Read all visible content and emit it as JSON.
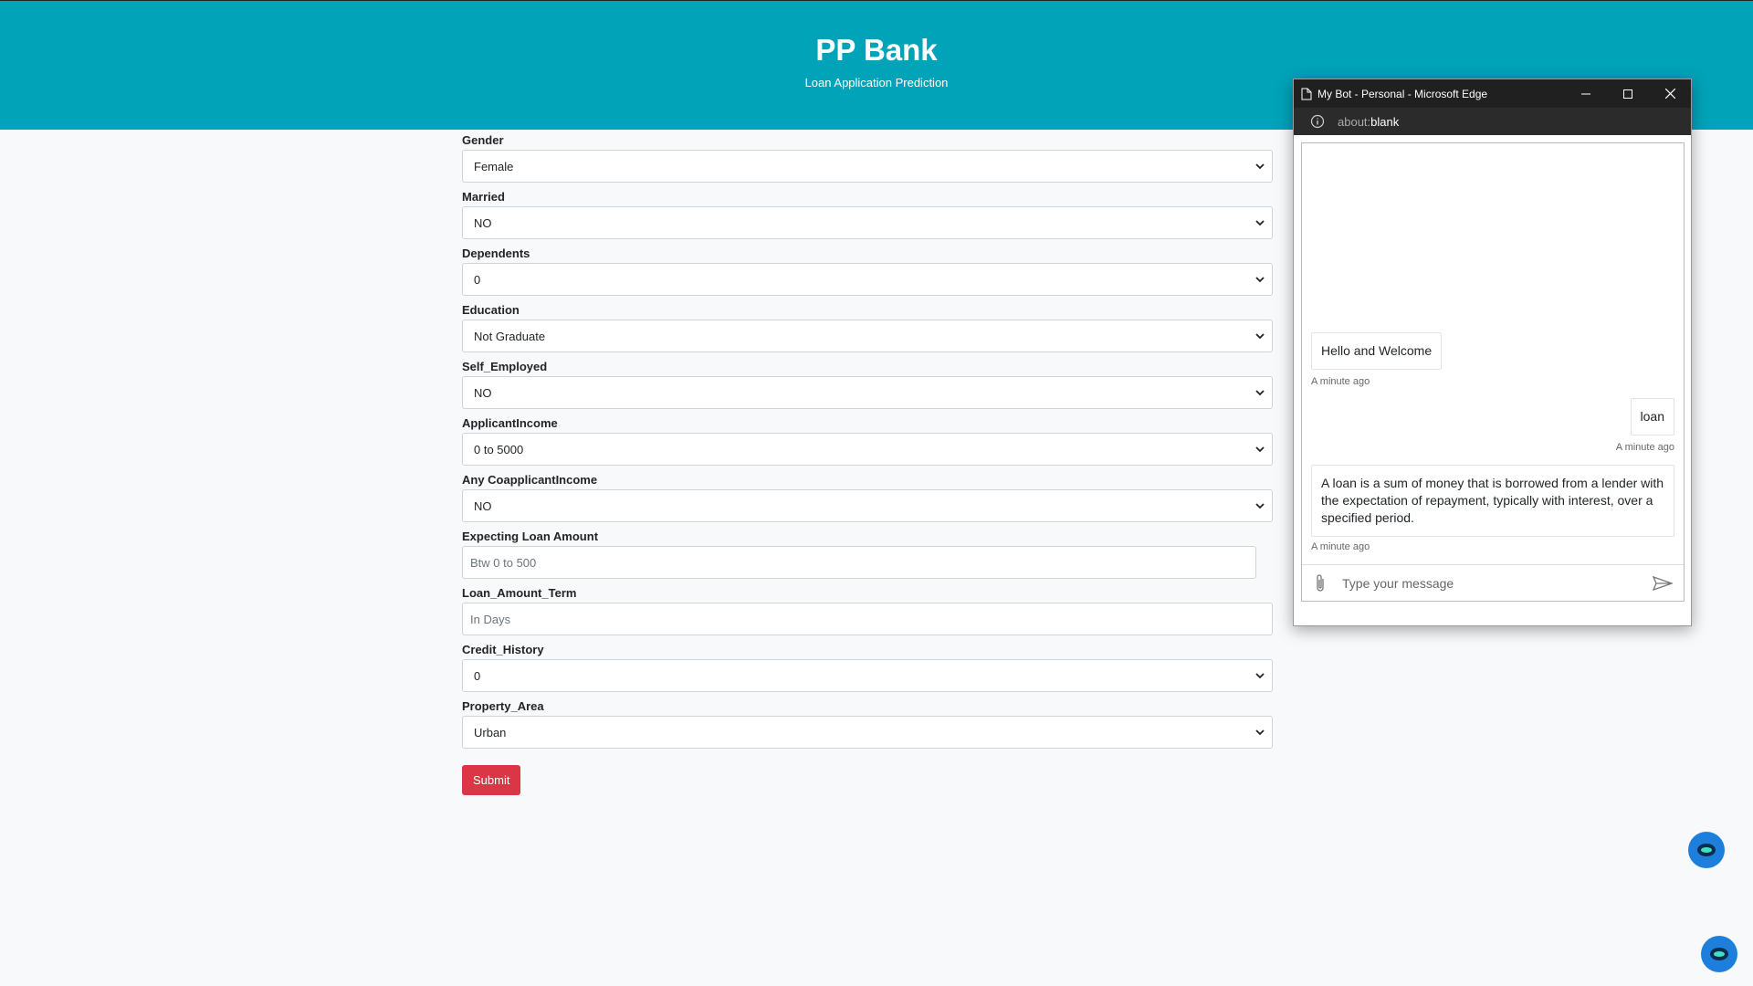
{
  "header": {
    "title": "PP Bank",
    "subtitle": "Loan Application Prediction"
  },
  "form": {
    "fields": [
      {
        "label": "Gender",
        "type": "select",
        "value": "Female"
      },
      {
        "label": "Married",
        "type": "select",
        "value": "NO"
      },
      {
        "label": "Dependents",
        "type": "select",
        "value": "0"
      },
      {
        "label": "Education",
        "type": "select",
        "value": "Not Graduate"
      },
      {
        "label": "Self_Employed",
        "type": "select",
        "value": "NO"
      },
      {
        "label": "ApplicantIncome",
        "type": "select",
        "value": "0 to 5000"
      },
      {
        "label": "Any CoapplicantIncome",
        "type": "select",
        "value": "NO"
      },
      {
        "label": "Expecting Loan Amount",
        "type": "input",
        "placeholder": "Btw 0 to 500"
      },
      {
        "label": "Loan_Amount_Term",
        "type": "input",
        "placeholder": "In Days"
      },
      {
        "label": "Credit_History",
        "type": "select",
        "value": "0"
      },
      {
        "label": "Property_Area",
        "type": "select",
        "value": "Urban"
      }
    ],
    "submit_label": "Submit"
  },
  "popup": {
    "window_title": "My Bot - Personal - Microsoft Edge",
    "address_prefix": "about:",
    "address_main": "blank",
    "messages": [
      {
        "from": "bot",
        "text": "Hello and Welcome",
        "time": "A minute ago"
      },
      {
        "from": "user",
        "text": "loan",
        "time": "A minute ago"
      },
      {
        "from": "bot",
        "text": "A loan is a sum of money that is borrowed from a lender with the expectation of repayment, typically with interest, over a specified period.",
        "time": "A minute ago"
      }
    ],
    "input_placeholder": "Type your message"
  },
  "colors": {
    "header_bg": "#00a3b8",
    "submit_bg": "#dc3545",
    "fab_bg": "#1d7fdb"
  }
}
